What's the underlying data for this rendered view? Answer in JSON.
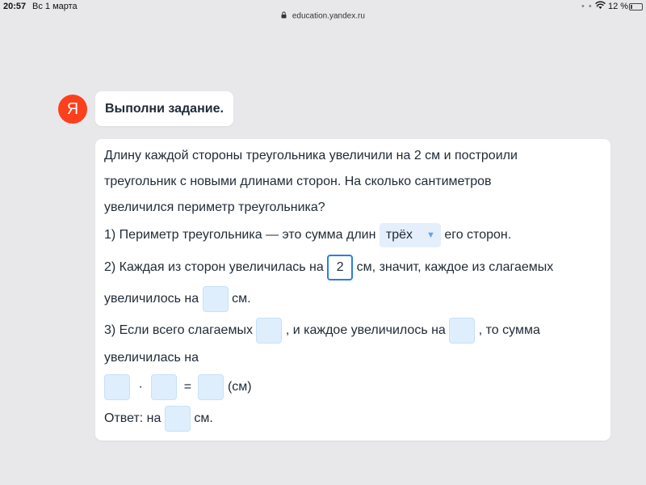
{
  "status_bar": {
    "time": "20:57",
    "date": "Вс 1 марта",
    "dots": "• • •",
    "battery": "12 %",
    "battery_level": 0.12
  },
  "url_bar": {
    "url": "education.yandex.ru"
  },
  "avatar": {
    "letter": "Я",
    "color": "#fc3f1d"
  },
  "title": "Выполни задание.",
  "task": {
    "text_line1": "Длину каждой стороны треугольника увеличили на 2 см и построили",
    "text_line2": "треугольник с новыми длинами сторон. На сколько сантиметров",
    "text_line3": "увеличился периметр треугольника?",
    "step1_prefix": "1) Периметр треугольника — это сумма длин",
    "step1_dropdown_value": "трёх",
    "step1_suffix": "его сторон.",
    "step2_prefix": "2) Каждая из сторон увеличилась на",
    "step2_value": "2",
    "step2_suffix": "см, значит, каждое из слагаемых",
    "step2_line2_prefix": "увеличилось на",
    "step2_line2_suffix": "см.",
    "step3_prefix": "3) Если всего слагаемых",
    "step3_middle": ", и каждое увеличилось на",
    "step3_suffix": ", то сумма",
    "step3_line2": "увеличилась на",
    "formula_times": "·",
    "formula_equals": "=",
    "formula_unit": "(см)",
    "answer_prefix": "Ответ: на",
    "answer_suffix": "см."
  }
}
